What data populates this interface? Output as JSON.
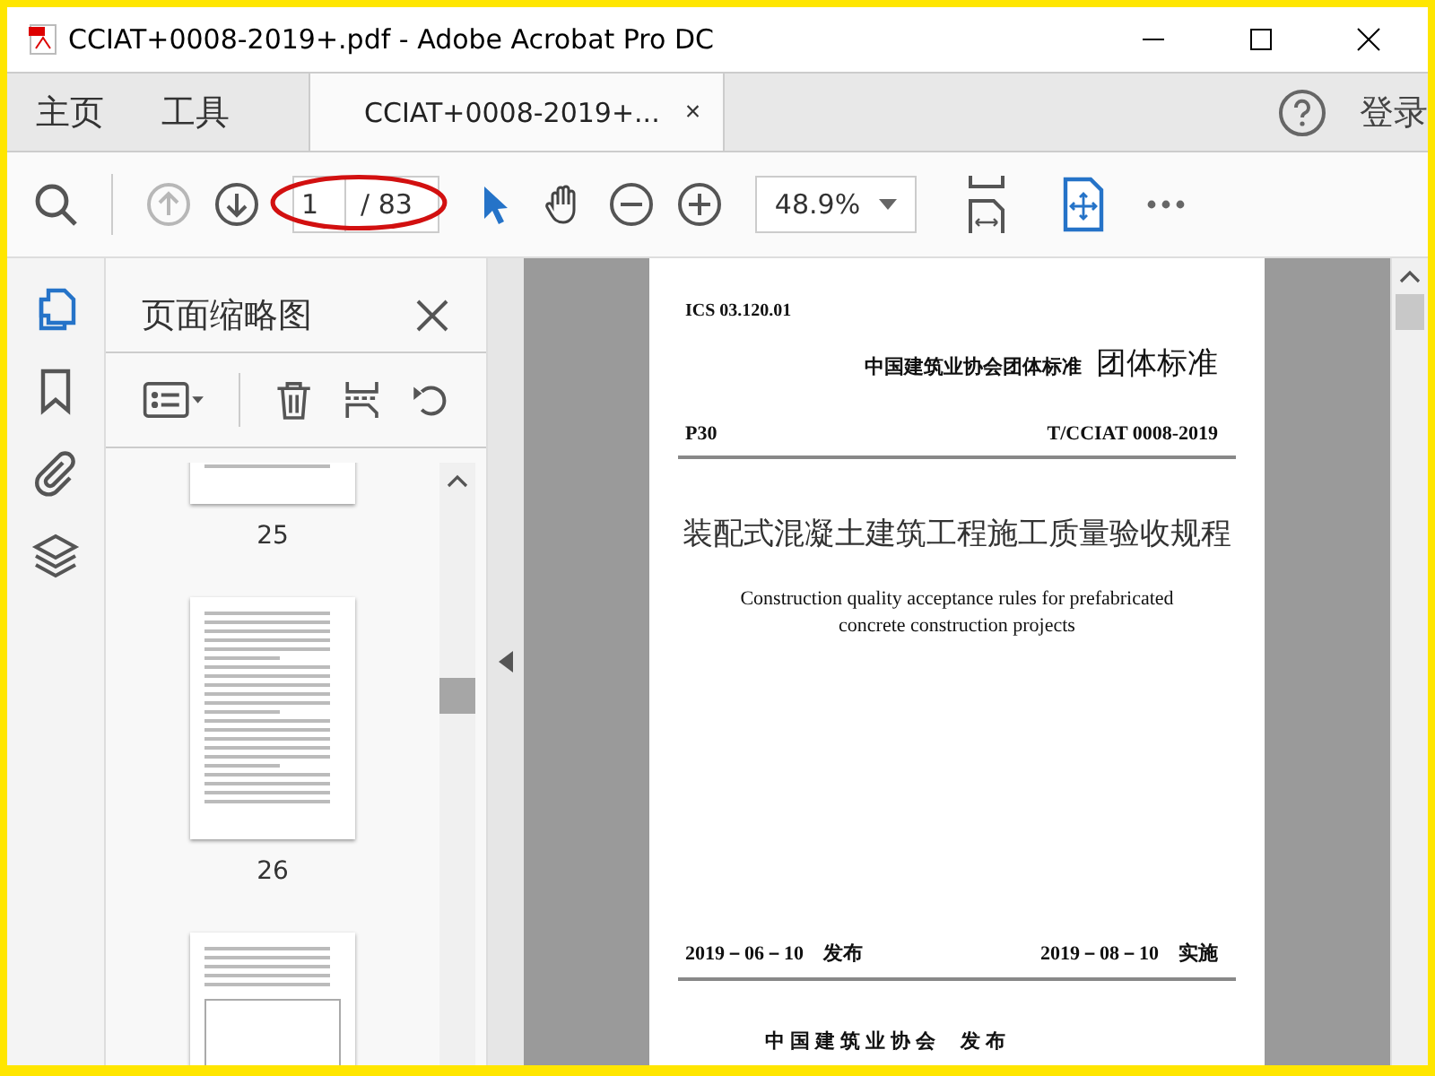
{
  "window": {
    "title": "CCIAT+0008-2019+.pdf - Adobe Acrobat Pro DC"
  },
  "nav_tabs": [
    {
      "label": "主页",
      "selected": false
    },
    {
      "label": "工具",
      "selected": false
    },
    {
      "label": "CCIAT+0008-2019+...",
      "selected": true,
      "close": "×"
    }
  ],
  "sign_in": "登录",
  "toolbar": {
    "prev_disabled": true,
    "page_number": "1",
    "page_total": "/ 83",
    "zoom": "48.9%"
  },
  "side_rail": [
    {
      "kind": "pages",
      "selected": true
    },
    {
      "kind": "bookmarks",
      "selected": false
    },
    {
      "kind": "attachments",
      "selected": false
    },
    {
      "kind": "layers",
      "selected": false
    }
  ],
  "thumbnail_panel": {
    "title": "页面缩略图",
    "thumbnails": [
      {
        "kind": "text",
        "label": "25"
      },
      {
        "kind": "text",
        "label": "26"
      },
      {
        "kind": "table"
      }
    ]
  },
  "document_page": {
    "ics": "ICS 03.120.01",
    "org_standard": "中国建筑业协会团体标准",
    "standard_type": "团体标准",
    "class_code": "P30",
    "standard_number": "T/CCIAT 0008-2019",
    "title_zh": "装配式混凝土建筑工程施工质量验收规程",
    "title_en": "Construction quality acceptance rules for prefabricated concrete construction projects",
    "publish_date": "2019－06－10　发布",
    "effective_date": "2019－08－10　实施",
    "publisher": "中 国 建 筑 业 协 会　 发 布"
  }
}
